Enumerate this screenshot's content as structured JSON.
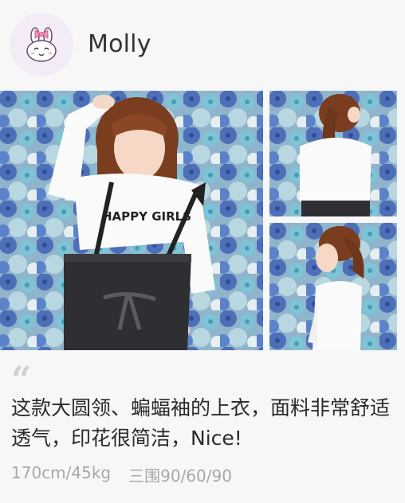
{
  "user": {
    "name": "Molly",
    "avatar_icon": "bunny-with-bow-icon"
  },
  "photos": {
    "main": {
      "shirt_text": "HAPPY GIRLS"
    }
  },
  "review": {
    "quote_mark": "“",
    "text": "这款大圆领、蝙蝠袖的上衣，面料非常舒适透气，印花很简洁，Nice!"
  },
  "meta": {
    "body_stats": "170cm/45kg",
    "measurements": "三围90/60/90"
  },
  "colors": {
    "background": "#f7f7f7",
    "avatar_bg": "#f3ecf7",
    "bow": "#f28fb5",
    "flower_blue": "#4d6fb8",
    "flower_teal": "#7ec3d6",
    "text_primary": "#2b2b2b",
    "text_secondary": "#a8a8a8"
  }
}
